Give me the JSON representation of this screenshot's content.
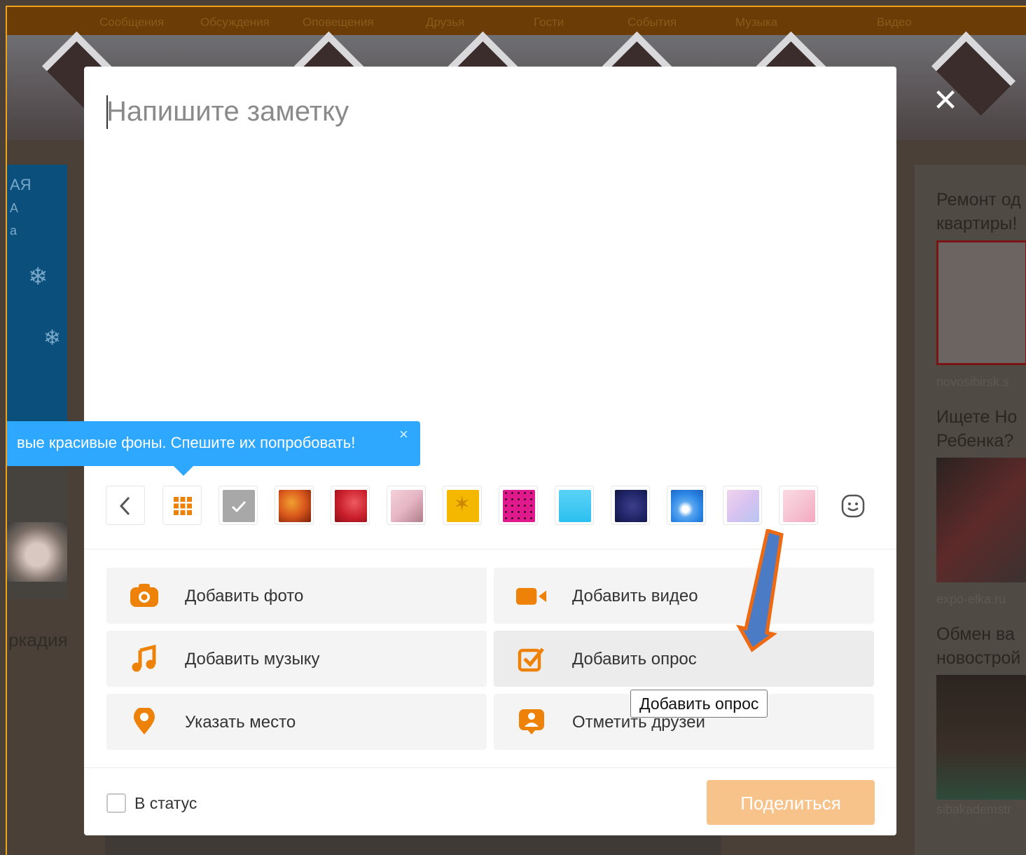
{
  "topnav": {
    "items": [
      "Сообщения",
      "Обсуждения",
      "Оповещения",
      "Друзья",
      "Гости",
      "События",
      "Музыка",
      "Видео"
    ]
  },
  "background": {
    "left_text": "ркадия",
    "left_col_text": [
      "АЯ",
      "А",
      "а"
    ],
    "ads": [
      {
        "title_line1": "Ремонт од",
        "title_line2": "квартиры!",
        "source": "novosibirsk.s"
      },
      {
        "title_line1": "Ищете Но",
        "title_line2": "Ребенка?",
        "source": "expo-elka.ru"
      },
      {
        "title_line1": "Обмен ва",
        "title_line2": "новострой",
        "source": "sibakademstr"
      }
    ]
  },
  "modal": {
    "note_placeholder": "Напишите заметку",
    "tip_text": "вые красивые фоны. Спешите их попробовать!",
    "tip_close": "×",
    "close_glyph": "✕",
    "swatches": [
      {
        "name": "gray-check",
        "color": "#a8a8a8"
      },
      {
        "name": "autumn-leaves",
        "color": "#d9571c"
      },
      {
        "name": "red-hearts",
        "color": "#c91f2b"
      },
      {
        "name": "pink-flowers",
        "color": "#e6b6c4"
      },
      {
        "name": "yellow-starfish",
        "color": "#f5b800"
      },
      {
        "name": "magenta-dots",
        "color": "#e0198c"
      },
      {
        "name": "sky-blue",
        "color": "#2cc0f0"
      },
      {
        "name": "navy-night",
        "color": "#1f2466"
      },
      {
        "name": "blue-abstract",
        "color": "#2c86e6"
      },
      {
        "name": "lilac-gradient",
        "color": "#d7c2f0"
      },
      {
        "name": "pink-gradient",
        "color": "#f6c4d4"
      }
    ],
    "actions": {
      "add_photo": "Добавить фото",
      "add_video": "Добавить видео",
      "add_music": "Добавить музыку",
      "add_poll": "Добавить опрос",
      "add_place": "Указать место",
      "tag_friends": "Отметить друзей"
    },
    "hover_hint": "Добавить опрос",
    "status_label": "В статус",
    "share_label": "Поделиться"
  },
  "colors": {
    "accent_orange": "#ee8208",
    "tip_blue": "#2ea8ff",
    "share_disabled": "#f7c38a"
  }
}
